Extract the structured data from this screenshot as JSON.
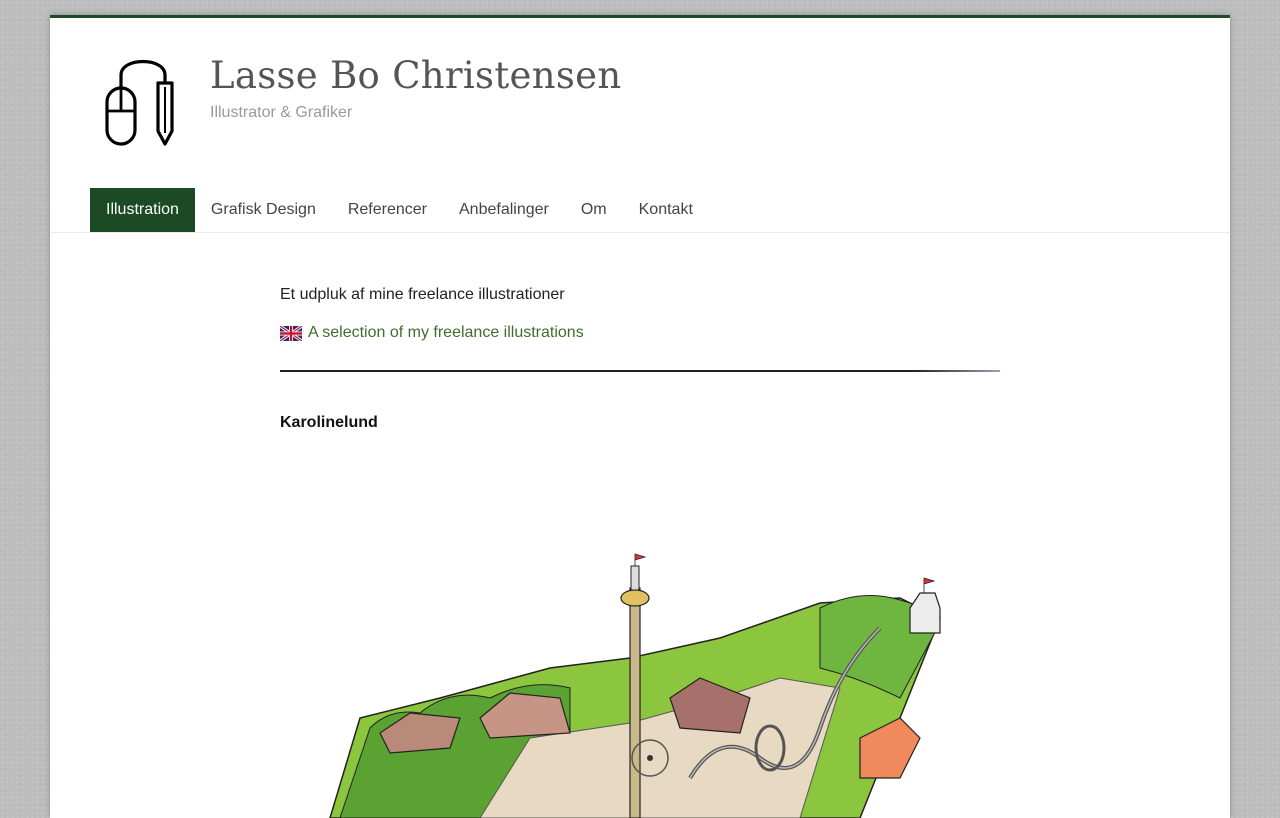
{
  "site": {
    "title": "Lasse Bo Christensen",
    "tagline": "Illustrator & Grafiker",
    "logo_icon": "mouse-and-pencil-icon",
    "accent_color": "#1b4a25"
  },
  "nav": {
    "items": [
      {
        "label": "Illustration",
        "active": true
      },
      {
        "label": "Grafisk Design",
        "active": false
      },
      {
        "label": "Referencer",
        "active": false
      },
      {
        "label": "Anbefalinger",
        "active": false
      },
      {
        "label": "Om",
        "active": false
      },
      {
        "label": "Kontakt",
        "active": false
      }
    ]
  },
  "content": {
    "intro": "Et udpluk af mine freelance illustrationer",
    "english_flag_icon": "uk-flag-icon",
    "english_link": "A selection of my freelance illustrations",
    "section_title": "Karolinelund",
    "link_color": "#3f6e2a"
  }
}
